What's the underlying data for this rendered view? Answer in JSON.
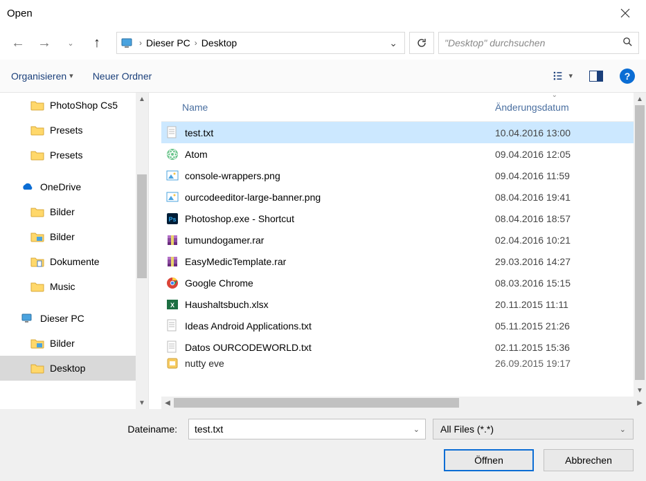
{
  "title": "Open",
  "breadcrumb": {
    "root_icon": "pc-icon",
    "parts": [
      "Dieser PC",
      "Desktop"
    ]
  },
  "search": {
    "placeholder": "\"Desktop\" durchsuchen"
  },
  "toolbar": {
    "organize": "Organisieren",
    "newfolder": "Neuer Ordner"
  },
  "filename": {
    "label": "Dateiname:",
    "value": "test.txt"
  },
  "filter": {
    "label": "All Files (*.*)"
  },
  "buttons": {
    "open": "Öffnen",
    "cancel": "Abbrechen"
  },
  "columns": {
    "name": "Name",
    "date": "Änderungsdatum"
  },
  "sidebar": [
    {
      "depth": 1,
      "icon": "folder",
      "label": "PhotoShop Cs5"
    },
    {
      "depth": 1,
      "icon": "folder",
      "label": "Presets"
    },
    {
      "depth": 1,
      "icon": "folder",
      "label": "Presets"
    },
    {
      "depth": 0,
      "icon": "onedrive",
      "label": "OneDrive",
      "gapTop": true
    },
    {
      "depth": 1,
      "icon": "folder",
      "label": "Bilder"
    },
    {
      "depth": 1,
      "icon": "picfolder",
      "label": "Bilder"
    },
    {
      "depth": 1,
      "icon": "docfolder",
      "label": "Dokumente"
    },
    {
      "depth": 1,
      "icon": "folder",
      "label": "Music"
    },
    {
      "depth": 0,
      "icon": "pc",
      "label": "Dieser PC",
      "gapTop": true
    },
    {
      "depth": 1,
      "icon": "picfolder",
      "label": "Bilder"
    },
    {
      "depth": 1,
      "icon": "folder",
      "label": "Desktop",
      "selected": true
    }
  ],
  "files": [
    {
      "icon": "txt",
      "name": "test.txt",
      "date": "10.04.2016 13:00",
      "selected": true
    },
    {
      "icon": "atom",
      "name": "Atom",
      "date": "09.04.2016 12:05"
    },
    {
      "icon": "img",
      "name": "console-wrappers.png",
      "date": "09.04.2016 11:59"
    },
    {
      "icon": "img",
      "name": "ourcodeeditor-large-banner.png",
      "date": "08.04.2016 19:41"
    },
    {
      "icon": "ps",
      "name": "Photoshop.exe - Shortcut",
      "date": "08.04.2016 18:57"
    },
    {
      "icon": "rar",
      "name": "tumundogamer.rar",
      "date": "02.04.2016 10:21"
    },
    {
      "icon": "rar",
      "name": "EasyMedicTemplate.rar",
      "date": "29.03.2016 14:27"
    },
    {
      "icon": "chrome",
      "name": "Google Chrome",
      "date": "08.03.2016 15:15"
    },
    {
      "icon": "xlsx",
      "name": "Haushaltsbuch.xlsx",
      "date": "20.11.2015 11:11"
    },
    {
      "icon": "txt",
      "name": "Ideas Android Applications.txt",
      "date": "05.11.2015 21:26"
    },
    {
      "icon": "txt",
      "name": "Datos OURCODEWORLD.txt",
      "date": "02.11.2015 15:36"
    },
    {
      "icon": "exe",
      "name": "nutty eve",
      "date": "26.09.2015 19:17",
      "cutoff": true
    }
  ]
}
